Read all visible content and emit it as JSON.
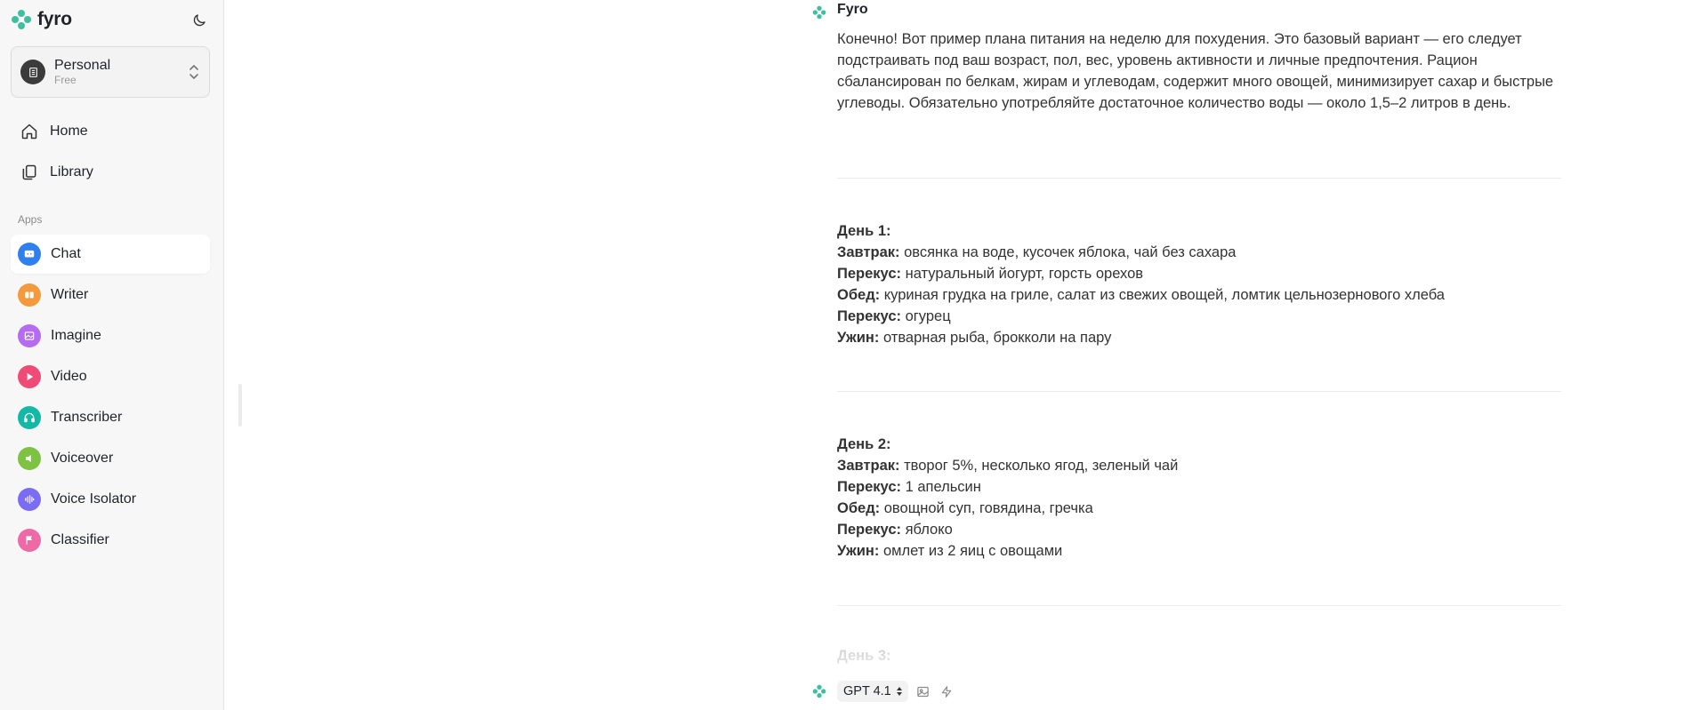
{
  "brand": {
    "name": "fyro"
  },
  "workspace": {
    "name": "Personal",
    "plan": "Free"
  },
  "nav": {
    "home": "Home",
    "library": "Library"
  },
  "apps_section_label": "Apps",
  "apps": [
    {
      "label": "Chat",
      "color": "#2f80ed",
      "icon": "chat-icon"
    },
    {
      "label": "Writer",
      "color": "#f39a3d",
      "icon": "writer-icon"
    },
    {
      "label": "Imagine",
      "color": "#b56cf0",
      "icon": "image-icon"
    },
    {
      "label": "Video",
      "color": "#ef4b77",
      "icon": "play-icon"
    },
    {
      "label": "Transcriber",
      "color": "#14b8a6",
      "icon": "headphones-icon"
    },
    {
      "label": "Voiceover",
      "color": "#7dc242",
      "icon": "speaker-icon"
    },
    {
      "label": "Voice Isolator",
      "color": "#7b6cf6",
      "icon": "waveform-icon"
    },
    {
      "label": "Classifier",
      "color": "#ee6aa7",
      "icon": "flag-icon"
    }
  ],
  "active_app": "Chat",
  "message": {
    "author": "Fyro",
    "intro": "Конечно! Вот пример плана питания на неделю для похудения. Это базовый вариант — его следует подстраивать под ваш возраст, пол, вес, уровень активности и личные предпочтения. Рацион сбалансирован по белкам, жирам и углеводам, содержит много овощей, минимизирует сахар и быстрые углеводы. Обязательно употребляйте достаточное количество воды — около 1,5–2 литров в день.",
    "days": [
      {
        "title": "День 1:",
        "meals": [
          {
            "label": "Завтрак:",
            "text": " овсянка на воде, кусочек яблока, чай без сахара"
          },
          {
            "label": "Перекус:",
            "text": " натуральный йогурт, горсть орехов"
          },
          {
            "label": "Обед:",
            "text": " куриная грудка на гриле, салат из свежих овощей, ломтик цельнозернового хлеба"
          },
          {
            "label": "Перекус:",
            "text": " огурец"
          },
          {
            "label": "Ужин:",
            "text": " отварная рыба, брокколи на пару"
          }
        ]
      },
      {
        "title": "День 2:",
        "meals": [
          {
            "label": "Завтрак:",
            "text": " творог 5%, несколько ягод, зеленый чай"
          },
          {
            "label": "Перекус:",
            "text": " 1 апельсин"
          },
          {
            "label": "Обед:",
            "text": " овощной суп, говядина, гречка"
          },
          {
            "label": "Перекус:",
            "text": " яблоко"
          },
          {
            "label": "Ужин:",
            "text": " омлет из 2 яиц с овощами"
          }
        ]
      }
    ],
    "next_day_title": "День 3:"
  },
  "composer": {
    "model": "GPT 4.1"
  },
  "colors": {
    "brand_teal": "#3fbfa0",
    "sidebar_bg": "#f7f7f7"
  }
}
